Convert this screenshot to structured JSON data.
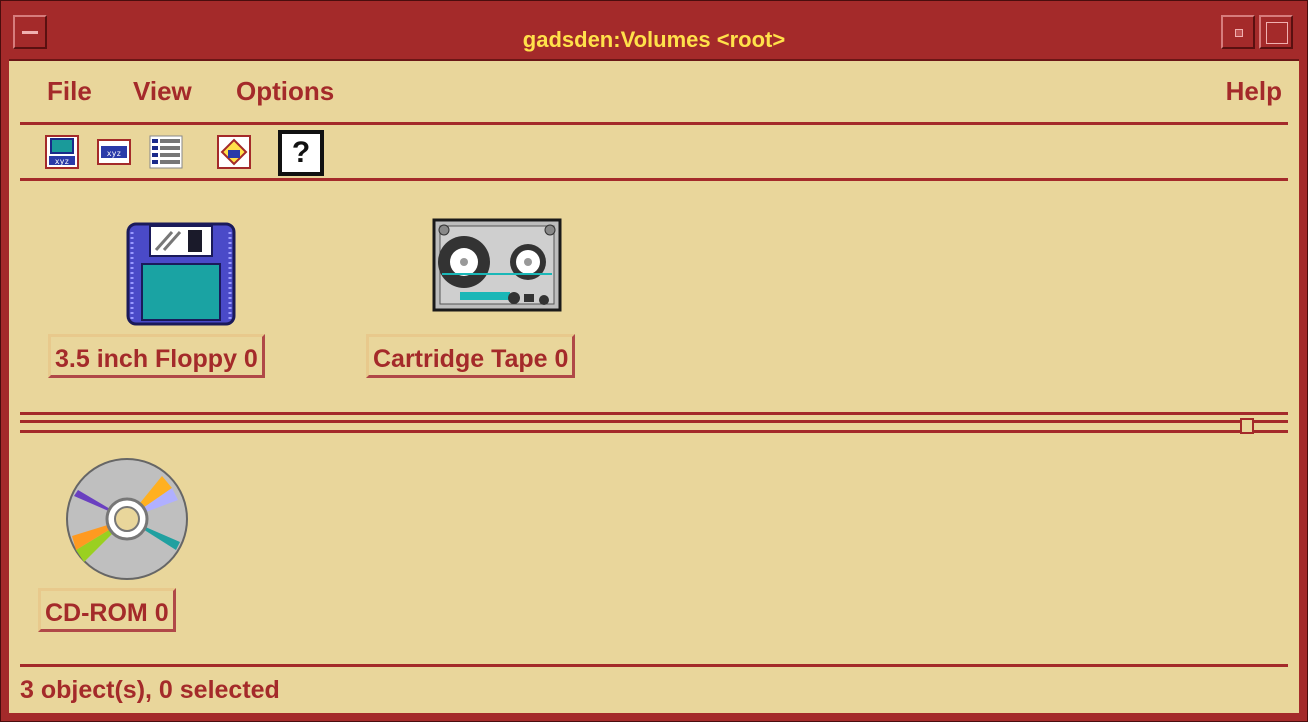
{
  "window": {
    "title": "gadsden:Volumes <root>"
  },
  "menu": {
    "file": "File",
    "view": "View",
    "options": "Options",
    "help": "Help"
  },
  "toolbar": {
    "help_label": "?"
  },
  "volumes": {
    "floppy": {
      "label": "3.5 inch Floppy 0",
      "icon": "floppy-disk-icon"
    },
    "tape": {
      "label": "Cartridge Tape 0",
      "icon": "cartridge-tape-icon"
    },
    "cdrom": {
      "label": "CD-ROM 0",
      "icon": "cd-rom-icon"
    }
  },
  "status": {
    "text": "3 object(s), 0 selected"
  },
  "colors": {
    "frame": "#a42a2a",
    "background": "#e9d69b",
    "title_text": "#ffe14a"
  }
}
